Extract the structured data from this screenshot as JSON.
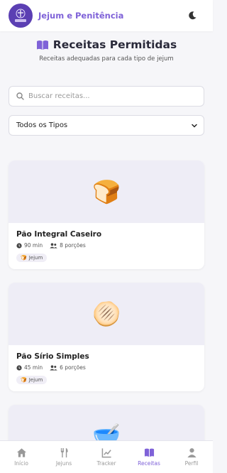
{
  "header": {
    "app_title": "Jejum e Penitência",
    "logo_text": "Jejum e Penitência"
  },
  "page": {
    "title": "Receitas Permitidas",
    "subtitle": "Receitas adequadas para cada tipo de jejum"
  },
  "search": {
    "placeholder": "Buscar receitas..."
  },
  "filter": {
    "selected": "Todos os Tipos"
  },
  "recipes": [
    {
      "title": "Pão Integral Caseiro",
      "time": "90 min",
      "servings": "8 porções",
      "tag": "Jejum",
      "emoji": "🍞"
    },
    {
      "title": "Pão Sírio Simples",
      "time": "45 min",
      "servings": "6 porções",
      "tag": "Jejum",
      "emoji": "🫓"
    },
    {
      "emoji": "🥣"
    }
  ],
  "nav": {
    "items": [
      {
        "label": "Início"
      },
      {
        "label": "Jejuns"
      },
      {
        "label": "Tracker"
      },
      {
        "label": "Receitas"
      },
      {
        "label": "Perfil"
      }
    ]
  },
  "colors": {
    "accent": "#7f62d8",
    "logo_bg": "#5b3fb3",
    "page_bg": "#f6f6f9",
    "card_img_bg": "#eeedf6"
  }
}
